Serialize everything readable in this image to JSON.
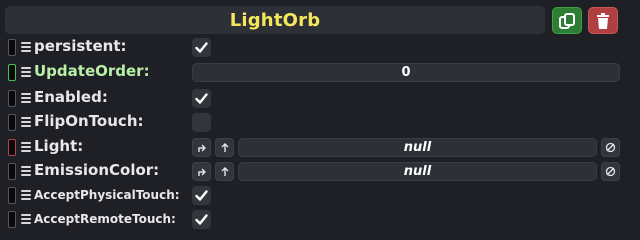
{
  "header": {
    "title": "LightOrb",
    "duplicate_icon": "duplicate-icon",
    "delete_icon": "trash-icon",
    "colors": {
      "title": "#f4e85a",
      "duplicate": "#2d7d34",
      "delete": "#b04040"
    }
  },
  "fields": [
    {
      "label": "persistent:",
      "type": "checkbox",
      "checked": true
    },
    {
      "label": "UpdateOrder:",
      "type": "number",
      "value": "0",
      "highlight": "green"
    },
    {
      "label": "Enabled:",
      "type": "checkbox",
      "checked": true
    },
    {
      "label": "FlipOnTouch:",
      "type": "checkbox",
      "checked": false
    },
    {
      "label": "Light:",
      "type": "reference",
      "value": "null",
      "highlight": "red"
    },
    {
      "label": "EmissionColor:",
      "type": "reference",
      "value": "null"
    },
    {
      "label": "AcceptPhysicalTouch:",
      "type": "checkbox",
      "checked": true
    },
    {
      "label": "AcceptRemoteTouch:",
      "type": "checkbox",
      "checked": true
    }
  ],
  "icons": {
    "drag": "drag-handle-icon",
    "check": "checkmark-icon",
    "jump": "jump-to-icon",
    "up": "arrow-up-icon",
    "clear": "null-clear-icon"
  }
}
